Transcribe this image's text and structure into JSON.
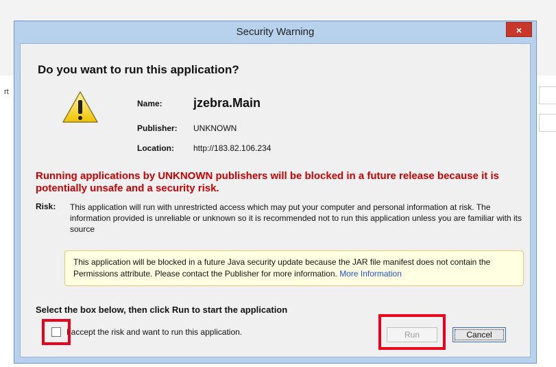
{
  "background": {
    "fragment_text": "rt"
  },
  "dialog": {
    "title": "Security Warning",
    "close_glyph": "×",
    "heading": "Do you want to run this application?",
    "warning_icon": "warning-triangle-icon",
    "fields": {
      "name_label": "Name:",
      "name_value": "jzebra.Main",
      "publisher_label": "Publisher:",
      "publisher_value": "UNKNOWN",
      "location_label": "Location:",
      "location_value": "http://183.82.106.234"
    },
    "red_warning": "Running applications by UNKNOWN publishers will be blocked in a future release because it is potentially unsafe and a security risk.",
    "risk_label": "Risk:",
    "risk_text": "This application will run with unrestricted access which may put your computer and personal information at risk. The information provided is unreliable or unknown so it is recommended not to run this application unless you are familiar with its source",
    "notice_text": "This application will be blocked in a future Java security update because the JAR file manifest does not contain the Permissions attribute. Please contact the Publisher for more information.",
    "notice_link": "More Information",
    "select_heading": "Select the box below, then click Run to start the application",
    "checkbox_label": "I accept the risk and want to run this application.",
    "checkbox_checked": false,
    "run_label": "Run",
    "cancel_label": "Cancel"
  },
  "colors": {
    "highlight": "#e8001c",
    "warning_text": "#cc0000",
    "link": "#1f4fd6",
    "title_bar": "#b8d1ec",
    "close_button": "#c7372a"
  }
}
